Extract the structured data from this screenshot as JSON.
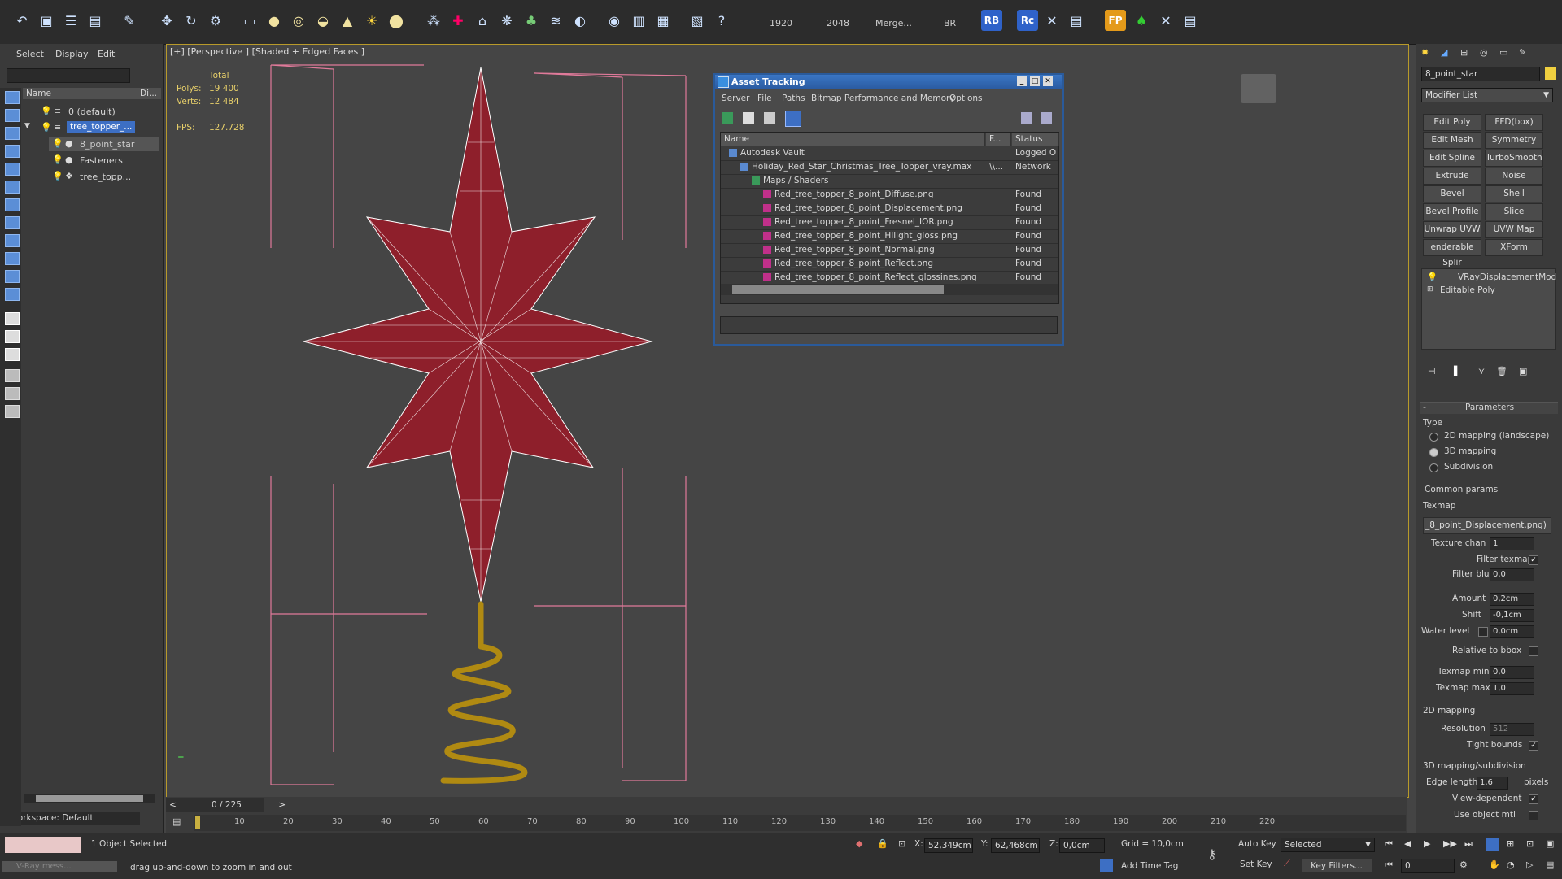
{
  "toolbar": {
    "render_width": "1920",
    "render_height": "2048",
    "merge_label": "Merge...",
    "br_label": "BR",
    "rb_badge": "RB",
    "rc_badge": "Rc",
    "fp_badge": "FP"
  },
  "scene_explorer": {
    "menu": [
      "Select",
      "Display",
      "Edit"
    ],
    "col_name": "Name",
    "col_display": "Di...",
    "items": [
      {
        "label": "0 (default)",
        "level": 0
      },
      {
        "label": "tree_topper_...",
        "level": 0
      },
      {
        "label": "8_point_star",
        "level": 1
      },
      {
        "label": "Fasteners",
        "level": 1
      },
      {
        "label": "tree_topp...",
        "level": 1
      }
    ],
    "workspace": "Workspace: Default"
  },
  "viewport": {
    "label": "[+] [Perspective ] [Shaded + Edged Faces ]",
    "stats_total": "Total",
    "polys_label": "Polys:",
    "polys_value": "19 400",
    "verts_label": "Verts:",
    "verts_value": "12 484",
    "fps_label": "FPS:",
    "fps_value": "127.728"
  },
  "asset_tracking": {
    "title": "Asset Tracking",
    "menu": [
      "Server",
      "File",
      "Paths",
      "Bitmap Performance and Memory",
      "Options"
    ],
    "columns": [
      "Name",
      "F...",
      "Status"
    ],
    "rows": [
      {
        "name": "Autodesk Vault",
        "f": "",
        "status": "Logged O",
        "indent": 1
      },
      {
        "name": "Holiday_Red_Star_Christmas_Tree_Topper_vray.max",
        "f": "\\\\...",
        "status": "Network",
        "indent": 2
      },
      {
        "name": "Maps / Shaders",
        "f": "",
        "status": "",
        "indent": 3
      },
      {
        "name": "Red_tree_topper_8_point_Diffuse.png",
        "f": "",
        "status": "Found",
        "indent": 4
      },
      {
        "name": "Red_tree_topper_8_point_Displacement.png",
        "f": "",
        "status": "Found",
        "indent": 4
      },
      {
        "name": "Red_tree_topper_8_point_Fresnel_IOR.png",
        "f": "",
        "status": "Found",
        "indent": 4
      },
      {
        "name": "Red_tree_topper_8_point_Hilight_gloss.png",
        "f": "",
        "status": "Found",
        "indent": 4
      },
      {
        "name": "Red_tree_topper_8_point_Normal.png",
        "f": "",
        "status": "Found",
        "indent": 4
      },
      {
        "name": "Red_tree_topper_8_point_Reflect.png",
        "f": "",
        "status": "Found",
        "indent": 4
      },
      {
        "name": "Red_tree_topper_8_point_Reflect_glossines.png",
        "f": "",
        "status": "Found",
        "indent": 4
      }
    ]
  },
  "command_panel": {
    "object_name": "8_point_star",
    "modifier_list": "Modifier List",
    "mod_buttons": [
      "Edit Poly",
      "FFD(box)",
      "Edit Mesh",
      "Symmetry",
      "Edit Spline",
      "TurboSmooth",
      "Extrude",
      "Noise",
      "Bevel",
      "Shell",
      "Bevel Profile",
      "Slice",
      "Unwrap UVW",
      "UVW Map",
      "enderable Splir",
      "XForm"
    ],
    "stack": [
      "VRayDisplacementMod",
      "Editable Poly"
    ],
    "params_title": "Parameters",
    "type_label": "Type",
    "type_options": [
      "2D mapping (landscape)",
      "3D mapping",
      "Subdivision"
    ],
    "type_selected": 1,
    "common_params": "Common params",
    "texmap_label": "Texmap",
    "texmap_value": "_8_point_Displacement.png)",
    "texture_chan_label": "Texture chan",
    "texture_chan_value": "1",
    "filter_texmap_label": "Filter texmap",
    "filter_blur_label": "Filter blur",
    "filter_blur_value": "0,0",
    "amount_label": "Amount",
    "amount_value": "0,2cm",
    "shift_label": "Shift",
    "shift_value": "-0,1cm",
    "water_level_label": "Water level",
    "water_level_value": "0,0cm",
    "relative_bbox_label": "Relative to bbox",
    "texmap_min_label": "Texmap min",
    "texmap_min_value": "0,0",
    "texmap_max_label": "Texmap max",
    "texmap_max_value": "1,0",
    "mapping2d_label": "2D mapping",
    "resolution_label": "Resolution",
    "resolution_value": "512",
    "tight_bounds_label": "Tight bounds",
    "mapping3d_label": "3D mapping/subdivision",
    "edge_length_label": "Edge length",
    "edge_length_value": "1,6",
    "pixels_label": "pixels",
    "view_dependent_label": "View-dependent",
    "use_object_mtl_label": "Use object mtl"
  },
  "timeline": {
    "frame_label": "0 / 225",
    "ticks": [
      "10",
      "20",
      "30",
      "40",
      "50",
      "60",
      "70",
      "80",
      "90",
      "100",
      "110",
      "120",
      "130",
      "140",
      "150",
      "160",
      "170",
      "180",
      "190",
      "200",
      "210",
      "220"
    ]
  },
  "status_bar": {
    "selection": "1 Object Selected",
    "prompt": "drag up-and-down to zoom in and out",
    "vray_msg": "V-Ray mess...",
    "x_label": "X:",
    "x_value": "52,349cm",
    "y_label": "Y:",
    "y_value": "62,468cm",
    "z_label": "Z:",
    "z_value": "0,0cm",
    "grid": "Grid = 10,0cm",
    "add_time_tag": "Add Time Tag",
    "auto_key": "Auto Key",
    "set_key": "Set Key",
    "selected": "Selected",
    "key_filters": "Key Filters...",
    "frame_value": "0"
  }
}
